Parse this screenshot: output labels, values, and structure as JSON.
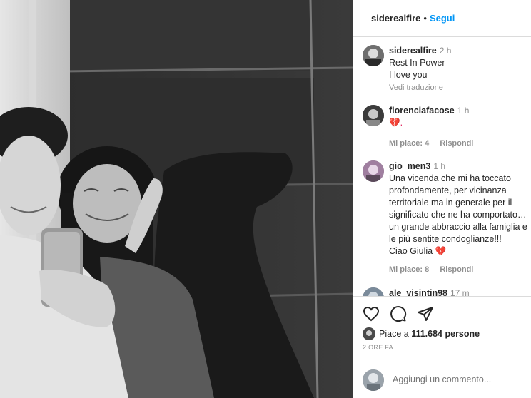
{
  "post": {
    "author": "siderealfire",
    "follow_label": "Segui",
    "separator": "•"
  },
  "comments": [
    {
      "username": "siderealfire",
      "time": "2 h",
      "lines": [
        "Rest In Power",
        "I love you"
      ],
      "see_translation": "Vedi traduzione"
    },
    {
      "username": "florenciafacose",
      "time": "1 h",
      "text": "💔.",
      "likes": "Mi piace: 4",
      "reply": "Rispondi"
    },
    {
      "username": "gio_men3",
      "time": "1 h",
      "lines": [
        "Una vicenda che mi ha toccato",
        "profondamente, per vicinanza",
        "territoriale ma in generale per il",
        "significato che ne ha comportato…",
        "un grande abbraccio alla famiglia e",
        "le più sentite condoglianze!!!",
        "Ciao Giulia 💔"
      ],
      "likes": "Mi piace: 8",
      "reply": "Rispondi"
    },
    {
      "username": "ale_visintin98",
      "time": "17 m"
    }
  ],
  "actions": {
    "like_icon": "heart-icon",
    "comment_icon": "comment-icon",
    "share_icon": "share-icon"
  },
  "likes_summary": {
    "prefix": "Piace a",
    "count": "111.684",
    "suffix": "persone"
  },
  "posted_ago": "2 ORE FA",
  "add_comment": {
    "placeholder": "Aggiungi un commento..."
  }
}
